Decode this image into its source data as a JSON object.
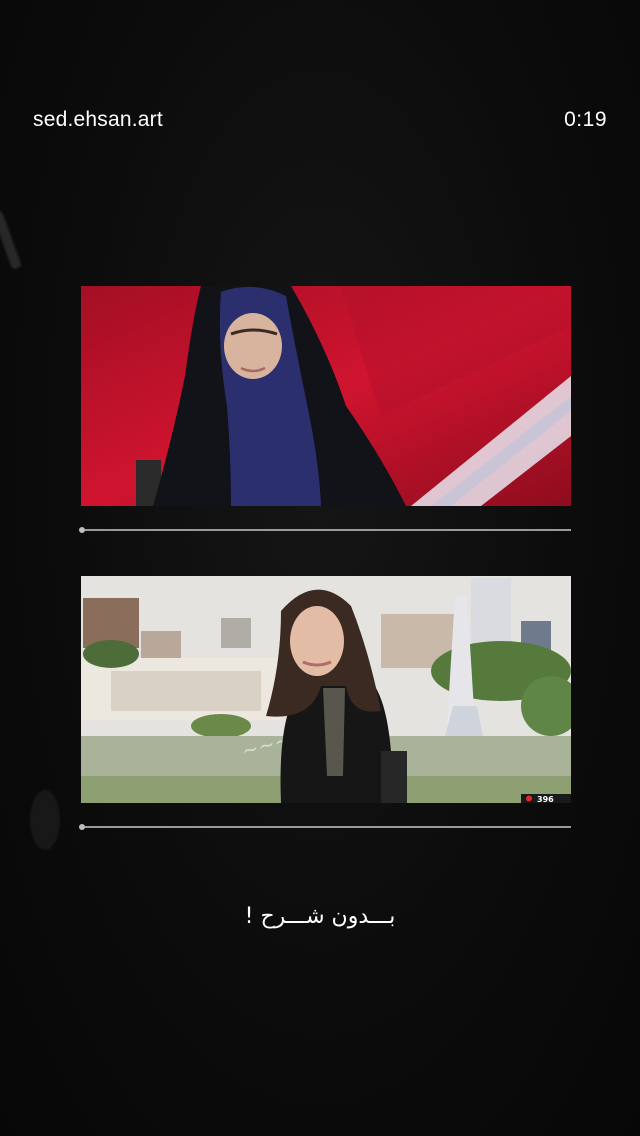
{
  "header": {
    "username": "sed.ehsan.art",
    "timer": "0:19"
  },
  "videos": [
    {
      "name": "top-clip",
      "progress": 0.0,
      "colors": {
        "studio_red": "#c1122a",
        "hijab_black": "#111318",
        "hijab_blue": "#2c2f6d"
      }
    },
    {
      "name": "bottom-clip",
      "progress": 0.0,
      "badge_text": "396",
      "colors": {
        "sky": "#e4e3df",
        "jacket": "#161616",
        "hair": "#3a2a22"
      }
    }
  ],
  "caption": "بـــدون شـــرح !"
}
